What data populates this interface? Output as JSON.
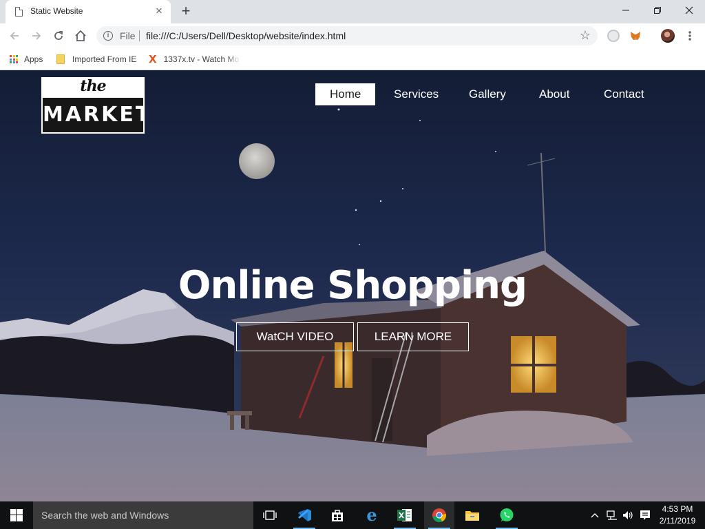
{
  "browser": {
    "tab": {
      "title": "Static Website"
    },
    "omnibox": {
      "scheme": "File",
      "url": "file:///C:/Users/Dell/Desktop/website/index.html"
    },
    "bookmarks": [
      {
        "label": "Apps"
      },
      {
        "label": "Imported From IE"
      },
      {
        "label": "1337x.tv - Watch Mo"
      }
    ]
  },
  "site": {
    "logo": {
      "small": "the",
      "large": "MARKET"
    },
    "nav": [
      {
        "label": "Home",
        "active": true
      },
      {
        "label": "Services"
      },
      {
        "label": "Gallery"
      },
      {
        "label": "About"
      },
      {
        "label": "Contact"
      }
    ],
    "hero": {
      "title": "Online Shopping",
      "buttons": [
        {
          "label": "WatCH VIDEO"
        },
        {
          "label": "LEARN MORE"
        }
      ]
    }
  },
  "taskbar": {
    "search_placeholder": "Search the web and Windows",
    "apps": [
      "task-view",
      "visual-studio-code",
      "store",
      "edge",
      "excel",
      "chrome",
      "file-explorer",
      "whatsapp"
    ],
    "clock": {
      "time": "4:53 PM",
      "date": "2/11/2019"
    }
  },
  "colors": {
    "accent": "#76b9ed",
    "taskbar": "#101112",
    "tabstrip": "#dee1e6"
  }
}
